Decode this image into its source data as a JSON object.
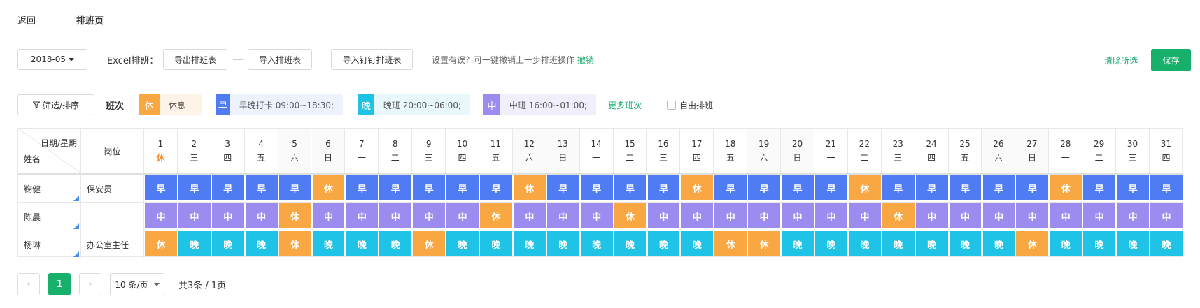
{
  "header": {
    "back": "返回",
    "title": "排班页"
  },
  "toolbar": {
    "month": "2018-05",
    "excel_label": "Excel排班：",
    "export": "导出排班表",
    "import": "导入排班表",
    "import_dingtalk": "导入钉钉排班表",
    "undo_hint": "设置有误？可一键撤销上一步排班操作",
    "undo": "撤销",
    "clear": "清除所选",
    "save": "保存"
  },
  "legend": {
    "filter": "筛选/排序",
    "label": "班次",
    "items": [
      {
        "char": "休",
        "text": "休息",
        "color": "#f8a743",
        "bg": "#fdf3e6"
      },
      {
        "char": "早",
        "text": "早晚打卡  09:00~18:30;",
        "color": "#4f7cf2",
        "bg": "#eef2fd"
      },
      {
        "char": "晚",
        "text": "晚班  20:00~06:00;",
        "color": "#1ec3e6",
        "bg": "#e8f8fc"
      },
      {
        "char": "中",
        "text": "中班  16:00~01:00;",
        "color": "#9c8cef",
        "bg": "#f2effd"
      }
    ],
    "more": "更多班次",
    "free": "自由排班"
  },
  "table": {
    "corner_top": "日期/星期",
    "corner_bottom": "姓名",
    "post_header": "岗位",
    "days": [
      {
        "d": "1",
        "w": "休"
      },
      {
        "d": "2",
        "w": "三"
      },
      {
        "d": "3",
        "w": "四"
      },
      {
        "d": "4",
        "w": "五"
      },
      {
        "d": "5",
        "w": "六"
      },
      {
        "d": "6",
        "w": "日"
      },
      {
        "d": "7",
        "w": "一"
      },
      {
        "d": "8",
        "w": "二"
      },
      {
        "d": "9",
        "w": "三"
      },
      {
        "d": "10",
        "w": "四"
      },
      {
        "d": "11",
        "w": "五"
      },
      {
        "d": "12",
        "w": "六"
      },
      {
        "d": "13",
        "w": "日"
      },
      {
        "d": "14",
        "w": "一"
      },
      {
        "d": "15",
        "w": "二"
      },
      {
        "d": "16",
        "w": "三"
      },
      {
        "d": "17",
        "w": "四"
      },
      {
        "d": "18",
        "w": "五"
      },
      {
        "d": "19",
        "w": "六"
      },
      {
        "d": "20",
        "w": "日"
      },
      {
        "d": "21",
        "w": "一"
      },
      {
        "d": "22",
        "w": "二"
      },
      {
        "d": "23",
        "w": "三"
      },
      {
        "d": "24",
        "w": "四"
      },
      {
        "d": "25",
        "w": "五"
      },
      {
        "d": "26",
        "w": "六"
      },
      {
        "d": "27",
        "w": "日"
      },
      {
        "d": "28",
        "w": "一"
      },
      {
        "d": "29",
        "w": "二"
      },
      {
        "d": "30",
        "w": "三"
      },
      {
        "d": "31",
        "w": "四"
      }
    ],
    "rows": [
      {
        "name": "鞠健",
        "post": "保安员",
        "shifts": [
          "早",
          "早",
          "早",
          "早",
          "早",
          "休",
          "早",
          "早",
          "早",
          "早",
          "早",
          "休",
          "早",
          "早",
          "早",
          "早",
          "休",
          "早",
          "早",
          "早",
          "早",
          "休",
          "早",
          "早",
          "早",
          "早",
          "早",
          "休",
          "早",
          "早",
          "早"
        ]
      },
      {
        "name": "陈晨",
        "post": "",
        "shifts": [
          "中",
          "中",
          "中",
          "中",
          "休",
          "中",
          "中",
          "中",
          "中",
          "中",
          "休",
          "中",
          "中",
          "中",
          "休",
          "中",
          "中",
          "中",
          "中",
          "中",
          "中",
          "中",
          "休",
          "中",
          "中",
          "中",
          "中",
          "中",
          "中",
          "中",
          "中"
        ]
      },
      {
        "name": "杨琳",
        "post": "办公室主任",
        "shifts": [
          "休",
          "晚",
          "晚",
          "晚",
          "休",
          "晚",
          "晚",
          "晚",
          "休",
          "晚",
          "晚",
          "晚",
          "晚",
          "晚",
          "晚",
          "晚",
          "晚",
          "休",
          "休",
          "晚",
          "晚",
          "晚",
          "晚",
          "晚",
          "晚",
          "晚",
          "休",
          "晚",
          "晚",
          "晚",
          "晚"
        ]
      }
    ]
  },
  "pager": {
    "prev": "‹",
    "current": "1",
    "next": "›",
    "size": "10 条/页",
    "total": "共3条 / 1页"
  },
  "colors": {
    "休": "#f8a743",
    "早": "#4f7cf2",
    "晚": "#1ec3e6",
    "中": "#9c8cef"
  }
}
